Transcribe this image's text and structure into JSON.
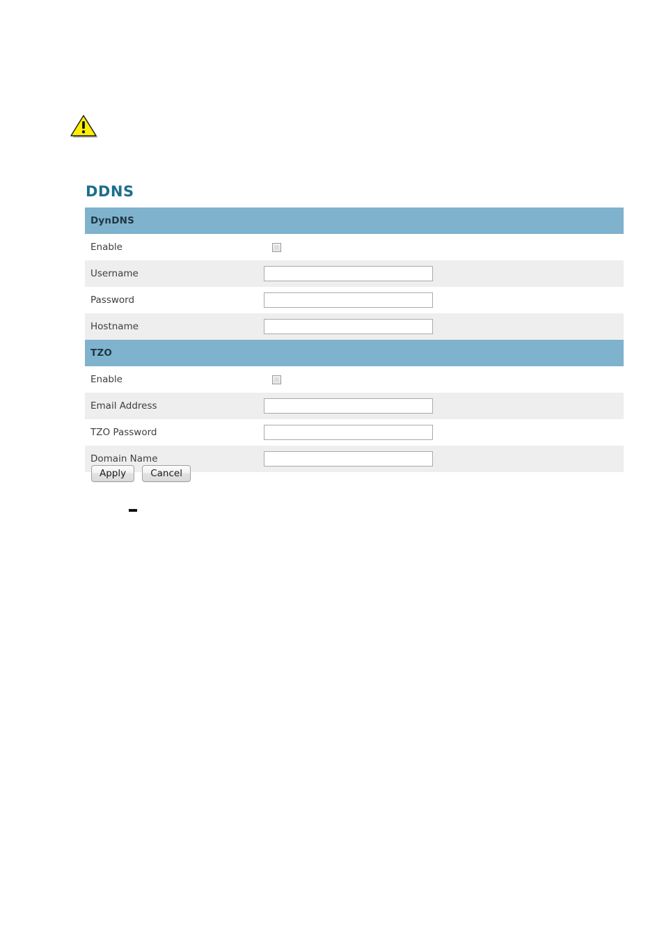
{
  "page": {
    "title": "DDNS",
    "warning_icon": "warning-triangle-icon",
    "trailing_dash": "–"
  },
  "table": {
    "groups": [
      {
        "header": "DynDNS",
        "rows": [
          {
            "label": "Enable",
            "type": "checkbox",
            "checked": false,
            "value": "",
            "placeholder": ""
          },
          {
            "label": "Username",
            "type": "text",
            "checked": false,
            "value": "",
            "placeholder": ""
          },
          {
            "label": "Password",
            "type": "text",
            "checked": false,
            "value": "",
            "placeholder": ""
          },
          {
            "label": "Hostname",
            "type": "text",
            "checked": false,
            "value": "",
            "placeholder": ""
          }
        ]
      },
      {
        "header": "TZO",
        "rows": [
          {
            "label": "Enable",
            "type": "checkbox",
            "checked": false,
            "value": "",
            "placeholder": ""
          },
          {
            "label": "Email Address",
            "type": "text",
            "checked": false,
            "value": "",
            "placeholder": ""
          },
          {
            "label": "TZO Password",
            "type": "text",
            "checked": false,
            "value": "",
            "placeholder": ""
          },
          {
            "label": "Domain Name",
            "type": "text",
            "checked": false,
            "value": "",
            "placeholder": ""
          }
        ]
      }
    ]
  },
  "buttons": {
    "apply": "Apply",
    "cancel": "Cancel"
  },
  "colors": {
    "group_header_bg": "#7fb2cd",
    "row_alt_bg": "#eeeeee",
    "row_bg": "#ffffff",
    "title_color": "#1d6e8c",
    "warning_fill": "#ffee00"
  }
}
